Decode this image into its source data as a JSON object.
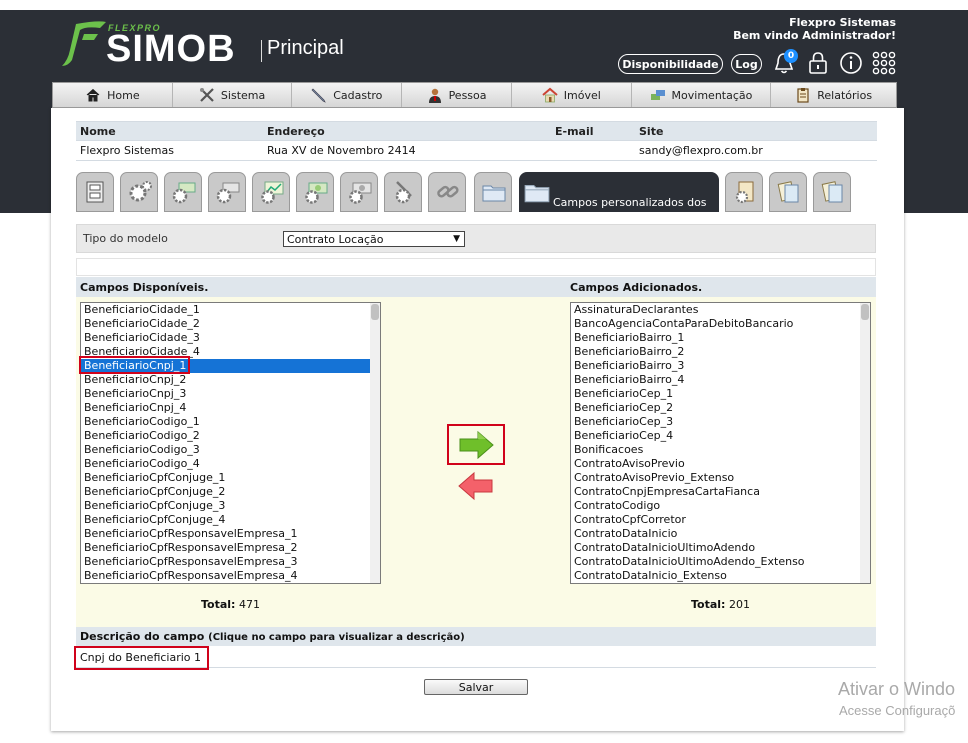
{
  "header": {
    "brand_small": "FLEXPRO",
    "brand": "SIMOB",
    "module": "Principal",
    "company": "Flexpro Sistemas",
    "welcome": "Bem vindo Administrador!",
    "btn_disponibilidade": "Disponibilidade",
    "btn_log": "Log",
    "notifications_count": "0",
    "icons": [
      "bell-icon",
      "lock-icon",
      "info-icon",
      "apps-grid-icon"
    ]
  },
  "nav": {
    "items": [
      {
        "label": "Home",
        "icon": "home-icon"
      },
      {
        "label": "Sistema",
        "icon": "tools-icon"
      },
      {
        "label": "Cadastro",
        "icon": "pen-icon"
      },
      {
        "label": "Pessoa",
        "icon": "person-icon"
      },
      {
        "label": "Imóvel",
        "icon": "house-icon"
      },
      {
        "label": "Movimentação",
        "icon": "transfer-icon"
      },
      {
        "label": "Relatórios",
        "icon": "report-icon"
      }
    ]
  },
  "info": {
    "headers": [
      "Nome",
      "Endereço",
      "E-mail",
      "Site"
    ],
    "values": [
      "Flexpro Sistemas",
      "Rua XV de Novembro 2414",
      "",
      "sandy@flexpro.com.br"
    ]
  },
  "tabs": {
    "active_label": "Campos personalizados dos",
    "icons": [
      "cabinet-icon",
      "gears-icon",
      "money-gear-icon",
      "money-gear-icon",
      "chart-gear-icon",
      "money-gear-icon",
      "money-gear-icon",
      "tools-gear-icon",
      "chain-icon",
      "folder-icon",
      "folder-icon",
      "clipboard-gear-icon",
      "documents-icon",
      "documents-icon"
    ]
  },
  "tipo_modelo": {
    "label": "Tipo do modelo",
    "selected": "Contrato Locação"
  },
  "disponiveis": {
    "title": "Campos Disponíveis.",
    "items": [
      "BeneficiarioCidade_1",
      "BeneficiarioCidade_2",
      "BeneficiarioCidade_3",
      "BeneficiarioCidade_4",
      "BeneficiarioCnpj_1",
      "BeneficiarioCnpj_2",
      "BeneficiarioCnpj_3",
      "BeneficiarioCnpj_4",
      "BeneficiarioCodigo_1",
      "BeneficiarioCodigo_2",
      "BeneficiarioCodigo_3",
      "BeneficiarioCodigo_4",
      "BeneficiarioCpfConjuge_1",
      "BeneficiarioCpfConjuge_2",
      "BeneficiarioCpfConjuge_3",
      "BeneficiarioCpfConjuge_4",
      "BeneficiarioCpfResponsavelEmpresa_1",
      "BeneficiarioCpfResponsavelEmpresa_2",
      "BeneficiarioCpfResponsavelEmpresa_3",
      "BeneficiarioCpfResponsavelEmpresa_4"
    ],
    "selected_index": 4,
    "total_label": "Total:",
    "total_value": "471"
  },
  "adicionados": {
    "title": "Campos Adicionados.",
    "items": [
      "AssinaturaDeclarantes",
      "BancoAgenciaContaParaDebitoBancario",
      "BeneficiarioBairro_1",
      "BeneficiarioBairro_2",
      "BeneficiarioBairro_3",
      "BeneficiarioBairro_4",
      "BeneficiarioCep_1",
      "BeneficiarioCep_2",
      "BeneficiarioCep_3",
      "BeneficiarioCep_4",
      "Bonificacoes",
      "ContratoAvisoPrevio",
      "ContratoAvisoPrevio_Extenso",
      "ContratoCnpjEmpresaCartaFianca",
      "ContratoCodigo",
      "ContratoCpfCorretor",
      "ContratoDataInicio",
      "ContratoDataInicioUltimoAdendo",
      "ContratoDataInicioUltimoAdendo_Extenso",
      "ContratoDataInicio_Extenso"
    ],
    "total_label": "Total:",
    "total_value": "201"
  },
  "descricao": {
    "title": "Descrição do campo",
    "hint": "(Clique no campo para visualizar a descrição)",
    "value": "Cnpj do Beneficiario 1"
  },
  "save_label": "Salvar",
  "watermark": {
    "line1": "Ativar o Windo",
    "line2": "Acesse Configuraçõ"
  }
}
